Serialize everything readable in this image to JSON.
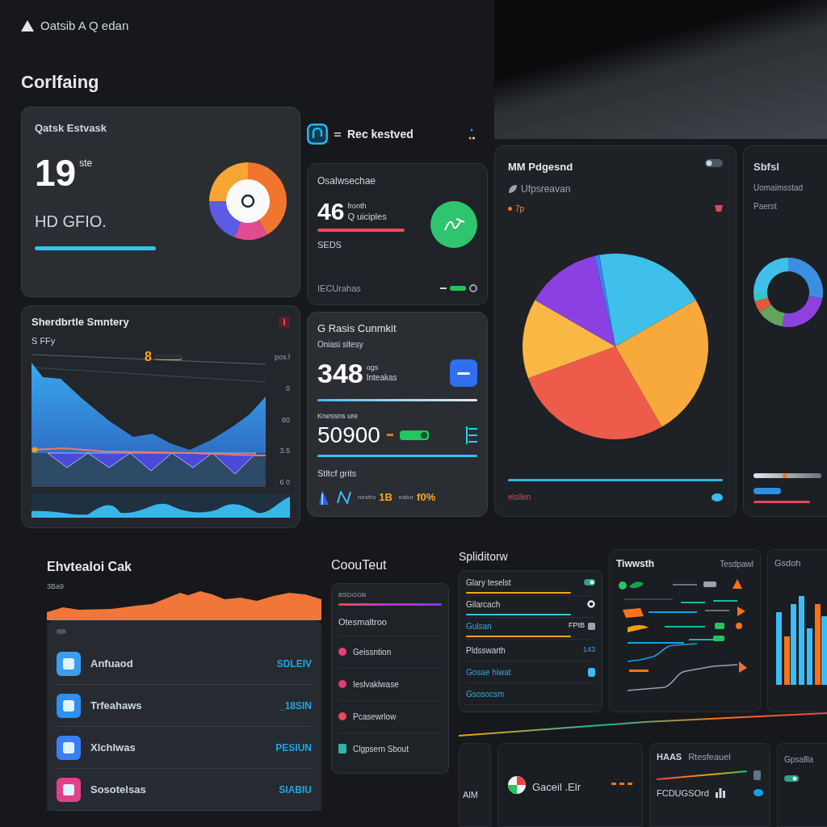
{
  "header": {
    "title": "Oatsib A Q edan",
    "heading": "Corlfaing"
  },
  "brand": {
    "name": "Rec kestved"
  },
  "summary_card": {
    "title": "Qatsk Estvask",
    "value": "19",
    "unit": "ste",
    "caption": "HD GFIO."
  },
  "users_card": {
    "title": "Osalwsechae",
    "value": "46",
    "note": "fronth",
    "caption": "Q uiciples",
    "sub": "SEDS",
    "footer": "IECUrahas"
  },
  "series_card": {
    "title": "Sherdbrtle Smntery",
    "label": "S FFy",
    "marker": "8",
    "axis_labels": [
      "pos.l",
      "0",
      "60",
      "3.5",
      "6 0"
    ]
  },
  "growth_card": {
    "title": "G Rasis Cunmkit",
    "subtitle": "Oniasi sitesy",
    "value": "348",
    "note": "ogs",
    "caption": "Inteakas",
    "metric_label": "Knessns ure",
    "metric_value": "50900",
    "section": "Stltcf grits",
    "stats": [
      {
        "caption": "nesfro",
        "value": "1B"
      },
      {
        "caption": "eatur",
        "value": "f0%"
      }
    ]
  },
  "pie_card": {
    "title": "MM Pdgesnd",
    "subtitle": "Ufpsreavan",
    "tag": "7p",
    "footer": "elsilen"
  },
  "ring_card": {
    "title": "Sbfsl",
    "subtitle": "Uomaimsstad",
    "note": "Paerst"
  },
  "apps_card": {
    "title": "Ehvtealoi Cak",
    "reading": "3Ba9",
    "rows": [
      {
        "name": "Anfuaod",
        "value": "SDLEIV",
        "color": "#3b9cf0"
      },
      {
        "name": "Trfeahaws",
        "value": "_18SIN",
        "color": "#2f8ff0"
      },
      {
        "name": "Xlchlwas",
        "value": "PESIUN",
        "color": "#3a7ff2"
      },
      {
        "name": "Sosotelsas",
        "value": "SIABIU",
        "color": "#e0428a"
      }
    ]
  },
  "content_card": {
    "title": "CoouTeut",
    "tag": "BSDGGB",
    "heading": "Otesmaltroo",
    "items": [
      {
        "kind": "dot",
        "label": "Geissntion",
        "color": "#e8407a"
      },
      {
        "kind": "dot",
        "label": "Ieslvaklwase",
        "color": "#e23a74"
      },
      {
        "kind": "dot",
        "label": "Pcasewrlow",
        "color": "#ea4a5a"
      },
      {
        "kind": "icon",
        "label": "Clgpsern Sbout",
        "color": "#2fb5a8"
      }
    ]
  },
  "split_card": {
    "title": "Spliditorw",
    "rows": [
      {
        "kind": "bar",
        "label": "Glary teselst",
        "accent": false,
        "color": "#f5a524"
      },
      {
        "kind": "bar",
        "label": "Gilarcach",
        "accent": false,
        "color": "#38c6d8"
      },
      {
        "kind": "bar",
        "label": "Gulsan",
        "accent": true,
        "color": "#f5a524",
        "reading": "FPIB"
      },
      {
        "kind": "text",
        "label": "Pldsswarth",
        "accent": false,
        "reading": "143"
      },
      {
        "kind": "text",
        "label": "Gosae hiwat",
        "accent": true
      },
      {
        "kind": "text",
        "label": "Gsosocsm",
        "accent": true
      }
    ]
  },
  "trend_card": {
    "title": "Tiwwsth",
    "subtitle": "Tesdpawl"
  },
  "bars_card": {
    "title": "Gsdoh"
  },
  "corner_card": {
    "title": "AlM"
  },
  "gauge_card": {
    "title": "Gaceil .Elr"
  },
  "health_card": {
    "code": "HAAS",
    "title": "Rtesfeauel",
    "value": "FCDUGSOrd"
  },
  "edge_card": {
    "title": "Gpsallla"
  }
}
